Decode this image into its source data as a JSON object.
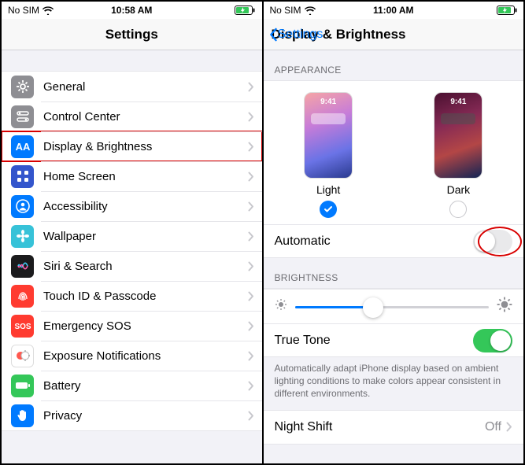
{
  "left": {
    "status": {
      "carrier": "No SIM",
      "time": "10:58 AM"
    },
    "title": "Settings",
    "items": [
      {
        "label": "General",
        "icon": "gear",
        "bg": "#8e8e93"
      },
      {
        "label": "Control Center",
        "icon": "switches",
        "bg": "#8e8e93"
      },
      {
        "label": "Display & Brightness",
        "icon": "aa",
        "bg": "#007aff",
        "highlight": true
      },
      {
        "label": "Home Screen",
        "icon": "grid",
        "bg": "#3355cc"
      },
      {
        "label": "Accessibility",
        "icon": "person",
        "bg": "#007aff"
      },
      {
        "label": "Wallpaper",
        "icon": "flower",
        "bg": "#37c2d8"
      },
      {
        "label": "Siri & Search",
        "icon": "siri",
        "bg": "#1b1b1d"
      },
      {
        "label": "Touch ID & Passcode",
        "icon": "fingerprint",
        "bg": "#ff3b30"
      },
      {
        "label": "Emergency SOS",
        "icon": "sos",
        "bg": "#ff3b30"
      },
      {
        "label": "Exposure Notifications",
        "icon": "exposure",
        "bg": "#ffffff"
      },
      {
        "label": "Battery",
        "icon": "battery",
        "bg": "#34c759"
      },
      {
        "label": "Privacy",
        "icon": "hand",
        "bg": "#007aff"
      }
    ]
  },
  "right": {
    "status": {
      "carrier": "No SIM",
      "time": "11:00 AM"
    },
    "back": "Settings",
    "title": "Display & Brightness",
    "appearance_header": "APPEARANCE",
    "mode_time": "9:41",
    "light_label": "Light",
    "dark_label": "Dark",
    "automatic_label": "Automatic",
    "automatic_on": false,
    "brightness_header": "BRIGHTNESS",
    "truetone_label": "True Tone",
    "truetone_on": true,
    "truetone_footer": "Automatically adapt iPhone display based on ambient lighting conditions to make colors appear consistent in different environments.",
    "nightshift_label": "Night Shift",
    "nightshift_value": "Off"
  }
}
